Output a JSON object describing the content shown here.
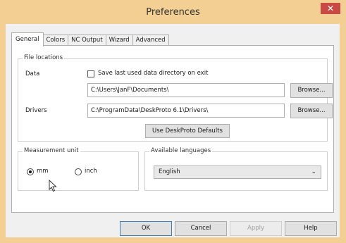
{
  "window": {
    "title": "Preferences",
    "close_glyph": "✕"
  },
  "tabs": [
    {
      "label": "General",
      "active": true
    },
    {
      "label": "Colors",
      "active": false
    },
    {
      "label": "NC Output",
      "active": false
    },
    {
      "label": "Wizard",
      "active": false
    },
    {
      "label": "Advanced",
      "active": false
    }
  ],
  "file_locations": {
    "legend": "File locations",
    "data_label": "Data",
    "save_last_label": "Save last used data directory on exit",
    "save_last_checked": false,
    "data_path": "C:\\Users\\JanF\\Documents\\",
    "drivers_label": "Drivers",
    "drivers_path": "C:\\ProgramData\\DeskProto 6.1\\Drivers\\",
    "browse_label": "Browse...",
    "defaults_label": "Use DeskProto Defaults"
  },
  "measurement": {
    "legend": "Measurement unit",
    "mm_label": "mm",
    "inch_label": "inch",
    "selected": "mm"
  },
  "languages": {
    "legend": "Available languages",
    "selected": "English"
  },
  "footer": {
    "ok_label": "OK",
    "cancel_label": "Cancel",
    "apply_label": "Apply",
    "help_label": "Help"
  },
  "icons": {
    "cursor": "mouse-cursor-icon",
    "dropdown": "chevron-down-icon"
  },
  "colors": {
    "titlebar": "#f3cf93",
    "close_button": "#c94a44",
    "dialog_bg": "#f0f0f0"
  }
}
